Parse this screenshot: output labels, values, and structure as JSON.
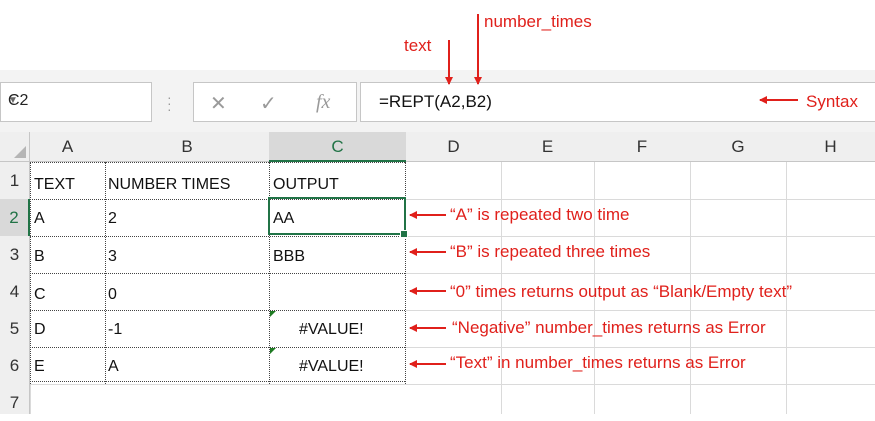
{
  "annotations": {
    "text_label": "text",
    "number_times_label": "number_times",
    "syntax_label": "Syntax",
    "notes": [
      "“A” is repeated two time",
      "“B” is repeated three times",
      "“0” times returns output as “Blank/Empty text”",
      "“Negative” number_times returns as Error",
      "“Text” in number_times returns as Error"
    ],
    "arrow_color": "#e0201b"
  },
  "formula_bar": {
    "name_box": "C2",
    "cancel_icon": "x-icon",
    "enter_icon": "check-icon",
    "fx_label": "fx",
    "formula": "=REPT(A2,B2)"
  },
  "grid": {
    "columns": [
      "A",
      "B",
      "C",
      "D",
      "E",
      "F",
      "G",
      "H"
    ],
    "rows": [
      "1",
      "2",
      "3",
      "4",
      "5",
      "6",
      "7"
    ],
    "selected_cell": "C2",
    "accent_color": "#217346",
    "cells": {
      "A1": "TEXT",
      "B1": "NUMBER TIMES",
      "C1": "OUTPUT",
      "A2": "A",
      "B2": "2",
      "C2": "AA",
      "A3": "B",
      "B3": "3",
      "C3": "BBB",
      "A4": "C",
      "B4": "0",
      "C4": "",
      "A5": "D",
      "B5": "-1",
      "C5": "#VALUE!",
      "A6": "E",
      "B6": "A",
      "C6": "#VALUE!"
    }
  }
}
